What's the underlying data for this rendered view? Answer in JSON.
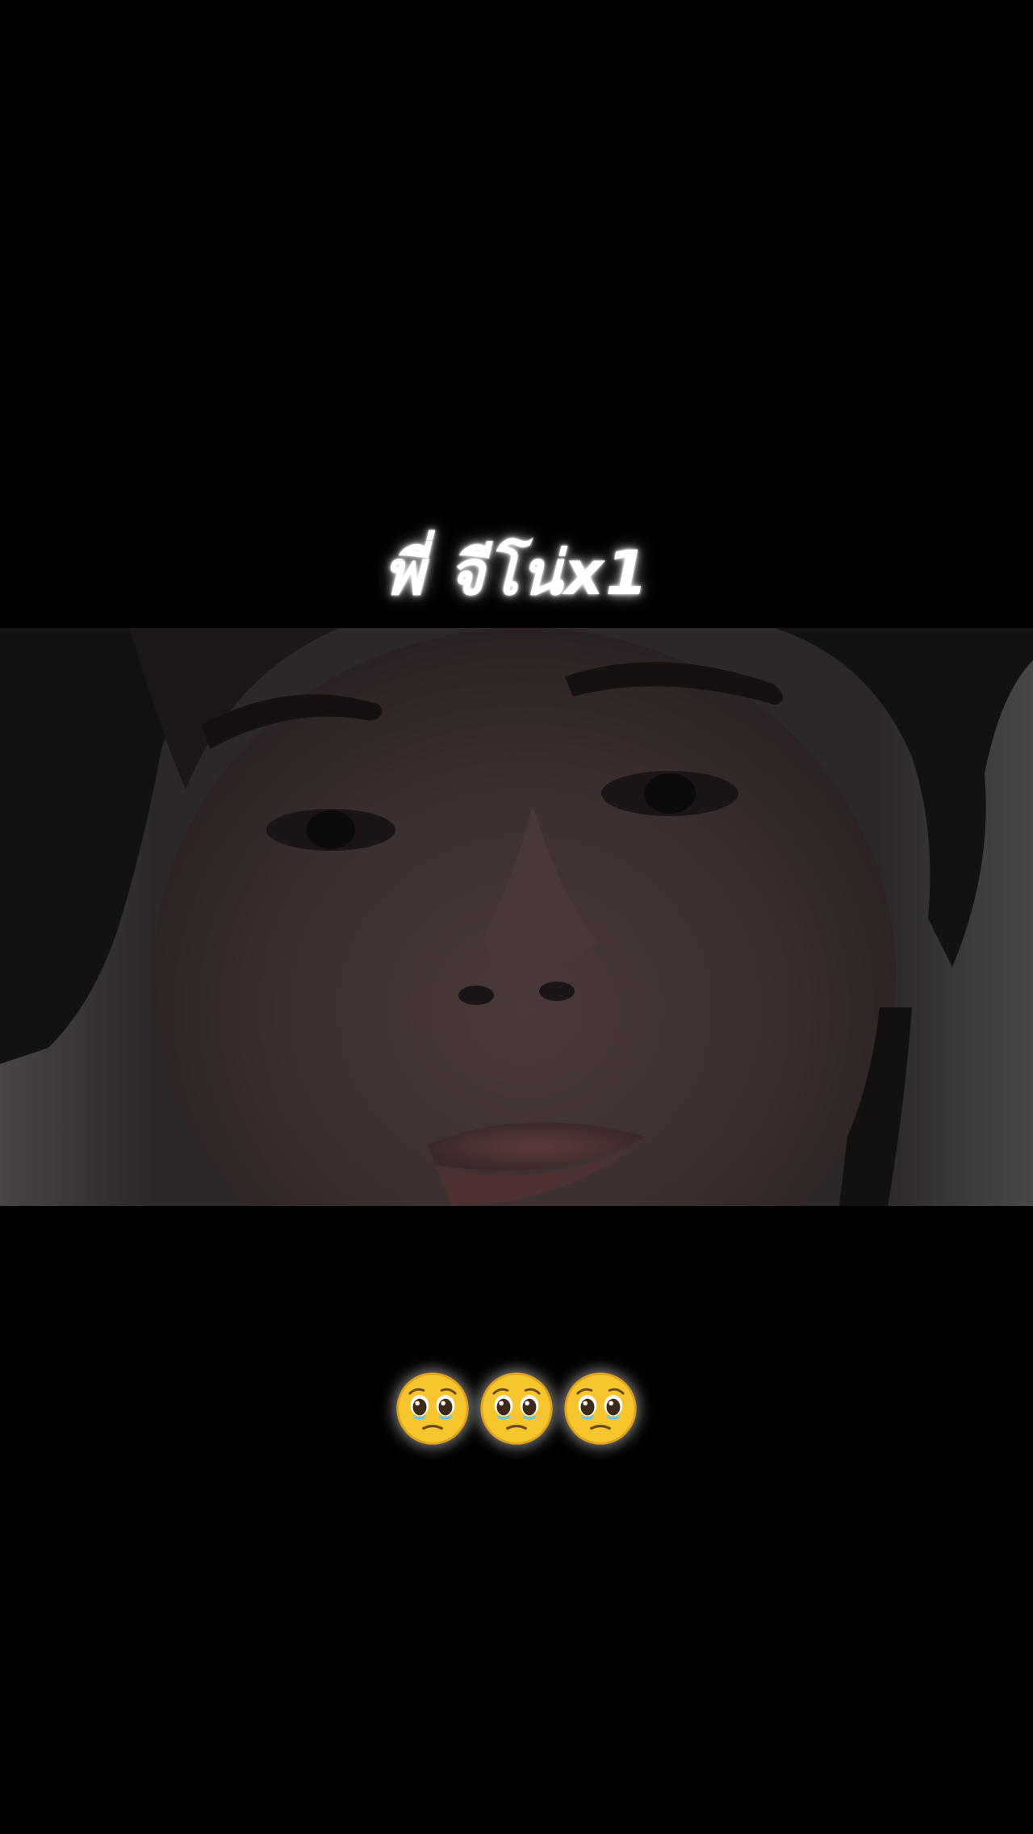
{
  "caption": {
    "text": "พี่ จีโน่x1"
  },
  "video": {
    "description_icon": "face-closeup-photo"
  },
  "emojis": {
    "icon": "pleading-face-icon",
    "count": 3
  },
  "colors": {
    "background": "#000000",
    "caption_text": "#ffffff",
    "emoji_face": "#f7c52c"
  }
}
